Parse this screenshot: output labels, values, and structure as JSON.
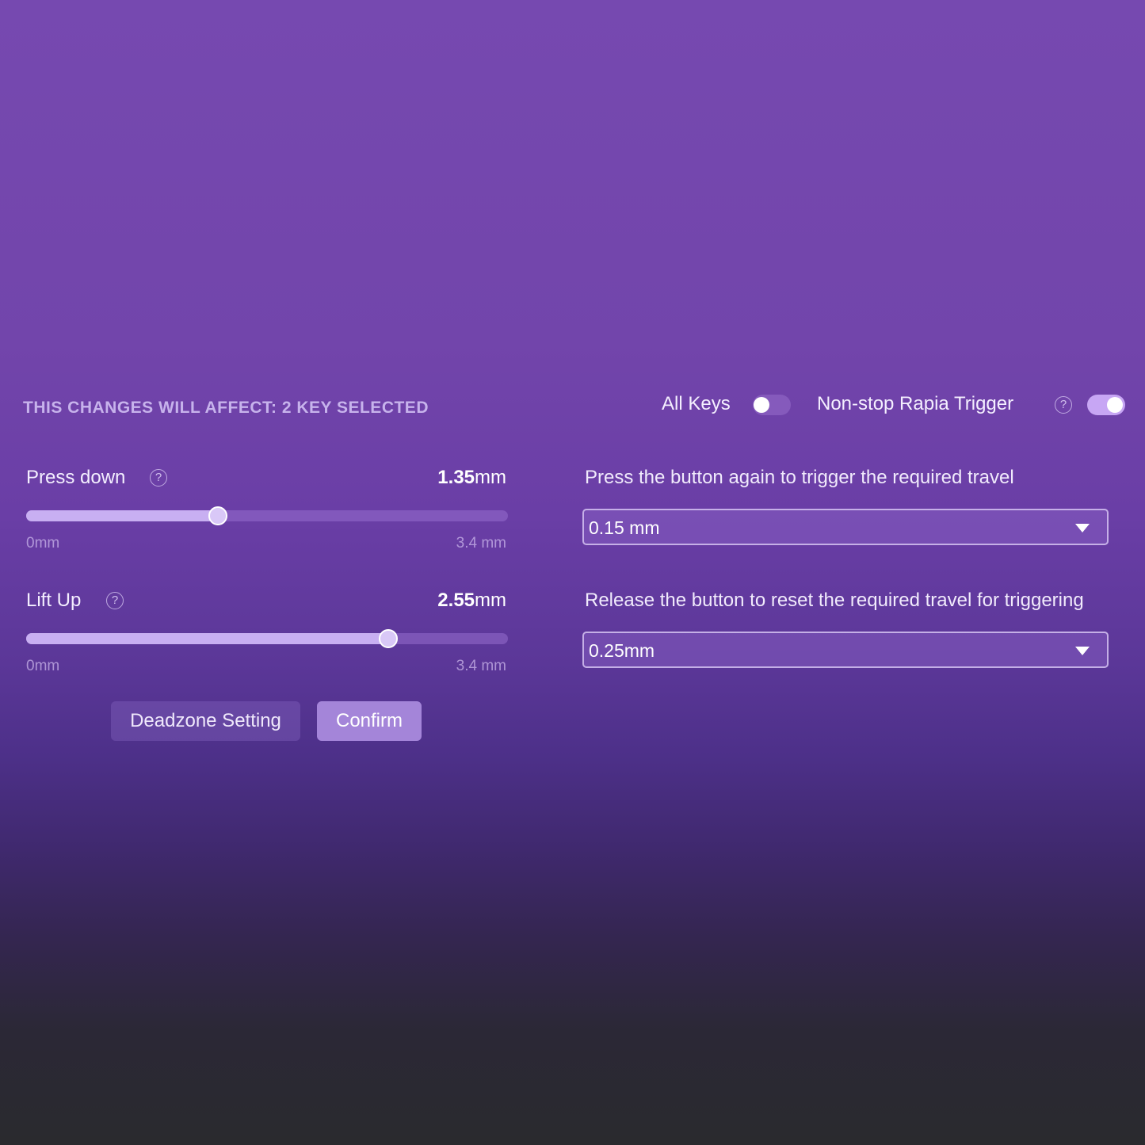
{
  "header": {
    "affect_text": "THIS CHANGES WILL AFFECT: 2 KEY SELECTED"
  },
  "toggles": {
    "all_keys": {
      "label": "All Keys",
      "on": false
    },
    "rapid_trigger": {
      "label": "Non-stop Rapia Trigger",
      "on": true
    }
  },
  "sliders": {
    "press_down": {
      "label": "Press down",
      "value_number": "1.35",
      "value_unit": "mm",
      "value": 1.35,
      "min": 0,
      "max": 3.4,
      "min_label": "0mm",
      "max_label": "3.4 mm"
    },
    "lift_up": {
      "label": "Lift Up",
      "value_number": "2.55",
      "value_unit": "mm",
      "value": 2.55,
      "min": 0,
      "max": 3.4,
      "min_label": "0mm",
      "max_label": "3.4 mm"
    }
  },
  "buttons": {
    "deadzone": "Deadzone Setting",
    "confirm": "Confirm"
  },
  "trigger_settings": {
    "press_description": "Press the button again to trigger the required travel",
    "press_value": "0.15 mm",
    "release_description": "Release the button to reset the required travel for triggering",
    "release_value": "0.25mm"
  },
  "icons": {
    "help": "?"
  },
  "colors": {
    "accent": "#c8aff2",
    "primary_button": "#a485d9"
  }
}
